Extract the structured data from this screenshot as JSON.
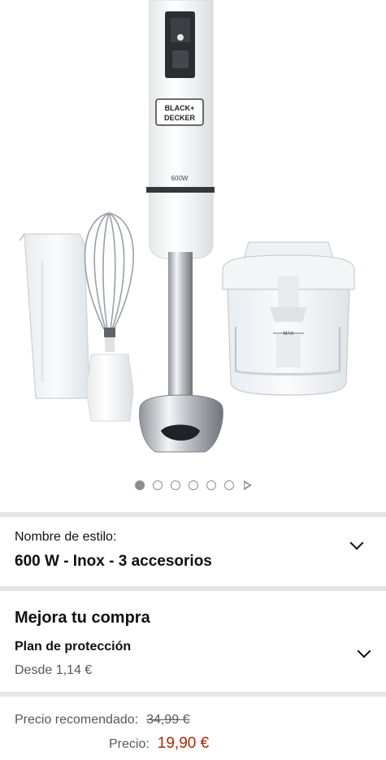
{
  "gallery": {
    "image_alt": "Batidora de mano",
    "brand_line1": "BLACK+",
    "brand_line2": "DECKER",
    "power_mark": "600W",
    "max_mark": "MAX",
    "total_images": 6,
    "current_image": 1
  },
  "style": {
    "label": "Nombre de estilo:",
    "value": "600 W - Inox - 3 accesorios"
  },
  "improve": {
    "title": "Mejora tu compra",
    "plan_title": "Plan de protección",
    "plan_price": "Desde 1,14 €"
  },
  "price": {
    "list_label": "Precio recomendado:",
    "list_value": "34,99 €",
    "deal_label": "Precio:",
    "deal_value": "19,90 €"
  },
  "colors": {
    "deal_price": "#b12704",
    "divider": "#e3e6e6",
    "text": "#0f1111",
    "secondary_text": "#565959"
  }
}
